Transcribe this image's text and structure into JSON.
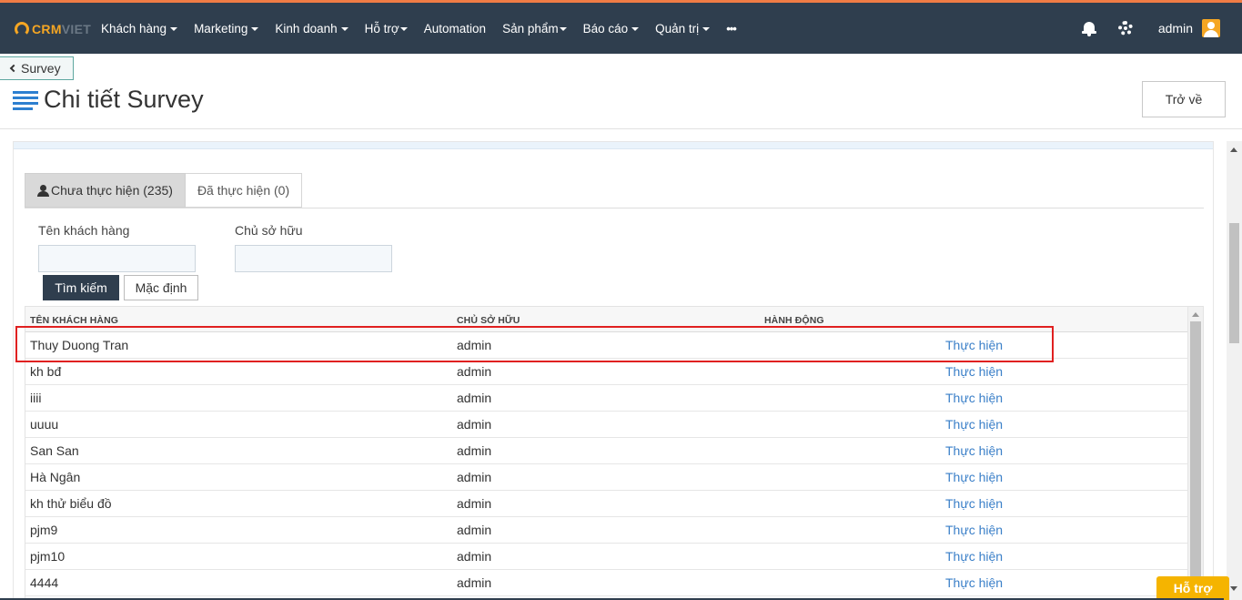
{
  "brand": {
    "crm": "CRM",
    "viet": "VIET"
  },
  "nav": {
    "items": [
      {
        "label": "Khách hàng",
        "caret": true
      },
      {
        "label": "Marketing",
        "caret": true
      },
      {
        "label": "Kinh doanh",
        "caret": true
      },
      {
        "label": "Hỗ trợ",
        "caret": true
      },
      {
        "label": "Automation",
        "caret": false
      },
      {
        "label": "Sản phẩm",
        "caret": true
      },
      {
        "label": "Báo cáo",
        "caret": true
      },
      {
        "label": "Quản trị",
        "caret": true
      }
    ],
    "more": "•••"
  },
  "user": {
    "name": "admin"
  },
  "breadcrumb": {
    "back_label": "Survey"
  },
  "page": {
    "title": "Chi tiết Survey",
    "back_button": "Trở về"
  },
  "tabs": [
    {
      "label": "Chưa thực hiện (235)",
      "active": true
    },
    {
      "label": "Đã thực hiện (0)",
      "active": false
    }
  ],
  "filters": {
    "customer_label": "Tên khách hàng",
    "customer_value": "",
    "owner_label": "Chủ sở hữu",
    "owner_value": "",
    "search_button": "Tìm kiếm",
    "default_button": "Mặc định"
  },
  "table": {
    "headers": [
      "TÊN KHÁCH HÀNG",
      "CHỦ SỞ HỮU",
      "HÀNH ĐỘNG"
    ],
    "rows": [
      {
        "name": "Thuy Duong Tran",
        "owner": "admin",
        "action": "Thực hiện"
      },
      {
        "name": "kh bđ",
        "owner": "admin",
        "action": "Thực hiện"
      },
      {
        "name": "iiii",
        "owner": "admin",
        "action": "Thực hiện"
      },
      {
        "name": "uuuu",
        "owner": "admin",
        "action": "Thực hiện"
      },
      {
        "name": "San San",
        "owner": "admin",
        "action": "Thực hiện"
      },
      {
        "name": "Hà Ngân",
        "owner": "admin",
        "action": "Thực hiện"
      },
      {
        "name": "kh thử biểu đồ",
        "owner": "admin",
        "action": "Thực hiện"
      },
      {
        "name": "pjm9",
        "owner": "admin",
        "action": "Thực hiện"
      },
      {
        "name": "pjm10",
        "owner": "admin",
        "action": "Thực hiện"
      },
      {
        "name": "4444",
        "owner": "admin",
        "action": "Thực hiện"
      }
    ]
  },
  "help": {
    "label": "Hỗ trợ"
  },
  "colors": {
    "navbar": "#2f3e4e",
    "accent": "#f07c45",
    "brand": "#f5a623",
    "link": "#3a7fc8",
    "highlight": "#e02020"
  }
}
